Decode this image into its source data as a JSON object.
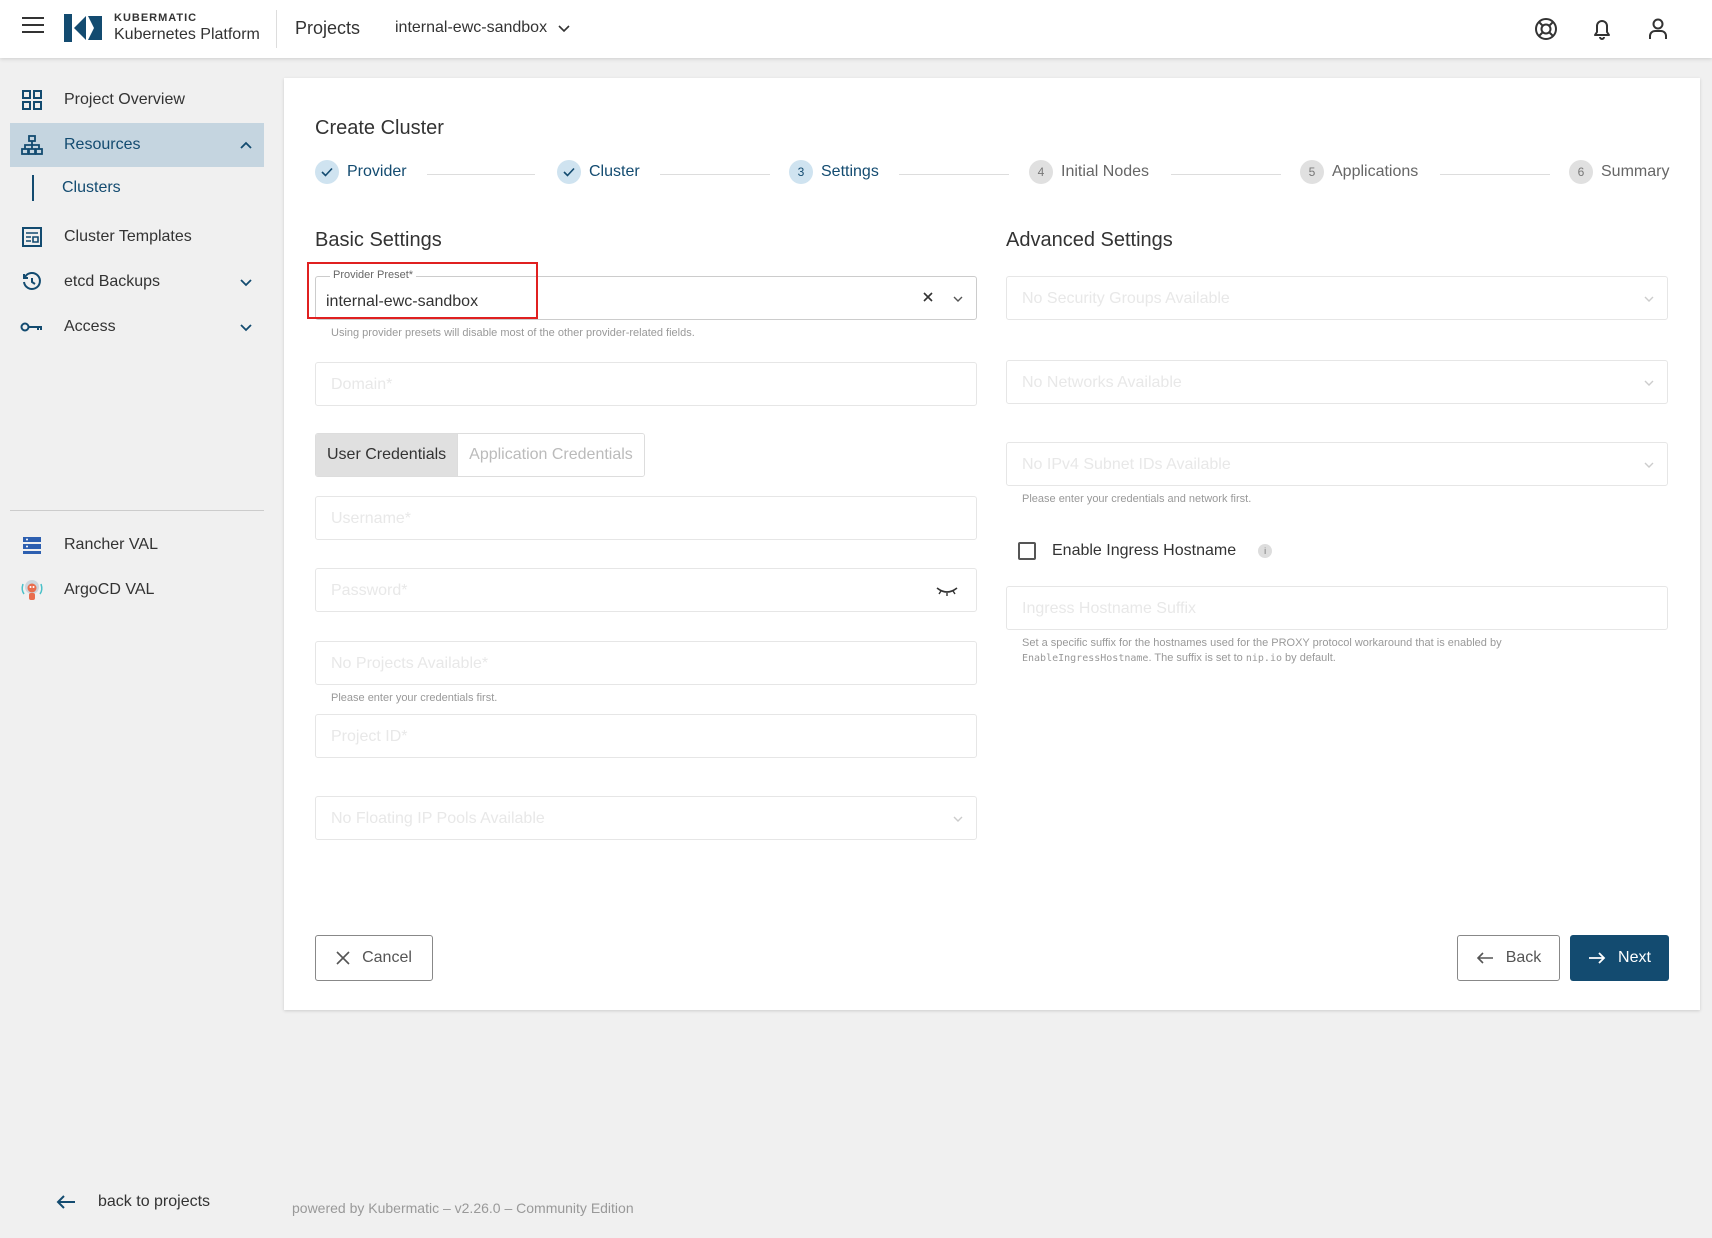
{
  "header": {
    "brand_top": "KUBERMATIC",
    "brand_bottom": "Kubernetes Platform",
    "projects_label": "Projects",
    "current_project": "internal-ewc-sandbox"
  },
  "sidebar": {
    "project_overview": "Project Overview",
    "resources": "Resources",
    "clusters": "Clusters",
    "cluster_templates": "Cluster Templates",
    "etcd_backups": "etcd Backups",
    "access": "Access",
    "rancher": "Rancher VAL",
    "argocd": "ArgoCD VAL",
    "back": "back to projects"
  },
  "page": {
    "title": "Create Cluster"
  },
  "stepper": [
    {
      "num": "✓",
      "label": "Provider",
      "state": "done"
    },
    {
      "num": "✓",
      "label": "Cluster",
      "state": "done"
    },
    {
      "num": "3",
      "label": "Settings",
      "state": "current"
    },
    {
      "num": "4",
      "label": "Initial Nodes",
      "state": "todo"
    },
    {
      "num": "5",
      "label": "Applications",
      "state": "todo"
    },
    {
      "num": "6",
      "label": "Summary",
      "state": "todo"
    }
  ],
  "basic": {
    "title": "Basic Settings",
    "preset_label": "Provider Preset*",
    "preset_value": "internal-ewc-sandbox",
    "preset_hint": "Using provider presets will disable most of the other provider-related fields.",
    "domain": "Domain*",
    "tab_user": "User Credentials",
    "tab_app": "Application Credentials",
    "username": "Username*",
    "password": "Password*",
    "projects": "No Projects Available*",
    "projects_hint": "Please enter your credentials first.",
    "project_id": "Project ID*",
    "floating_ip": "No Floating IP Pools Available"
  },
  "advanced": {
    "title": "Advanced Settings",
    "security_groups": "No Security Groups Available",
    "networks": "No Networks Available",
    "subnets": "No IPv4 Subnet IDs Available",
    "subnets_hint": "Please enter your credentials and network first.",
    "ingress_checkbox": "Enable Ingress Hostname",
    "ingress_suffix": "Ingress Hostname Suffix",
    "ingress_hint_1": "Set a specific suffix for the hostnames used for the PROXY protocol workaround that is enabled by",
    "ingress_hint_code1": "EnableIngressHostname",
    "ingress_hint_2": ". The suffix is set to",
    "ingress_hint_code2": "nip.io",
    "ingress_hint_3": "by default."
  },
  "actions": {
    "cancel": "Cancel",
    "back": "Back",
    "next": "Next"
  },
  "footer": {
    "text": "powered by Kubermatic  –  v2.26.0  –  Community Edition"
  },
  "colors": {
    "primary": "#134b70",
    "active_nav": "#c5d5e0",
    "highlight": "#e02020"
  }
}
